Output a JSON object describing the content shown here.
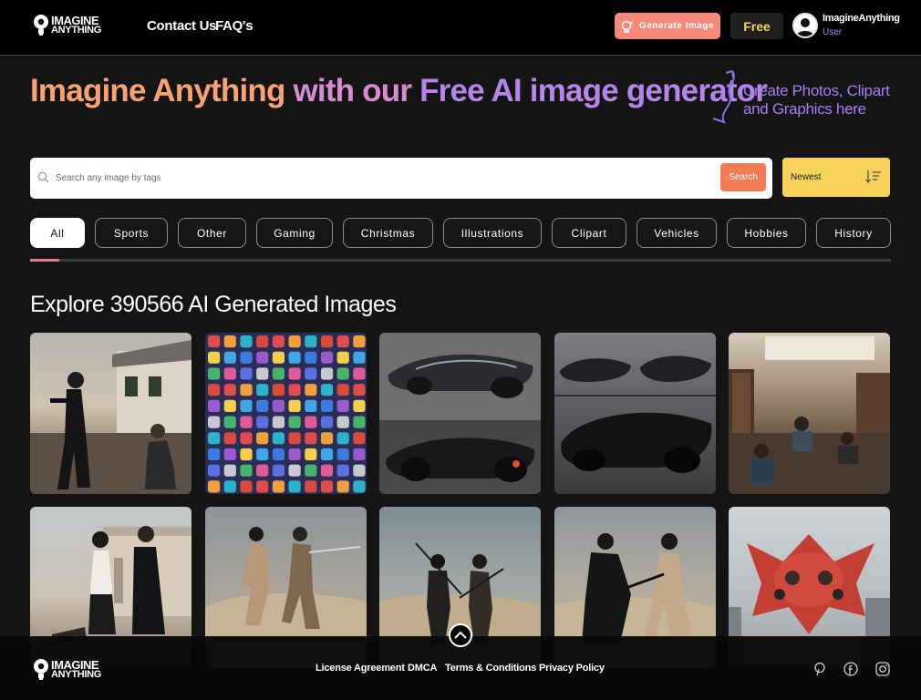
{
  "header": {
    "logo_line1": "IMAGINE",
    "logo_line2": "ANYTHING",
    "nav": [
      {
        "label": "Contact Us"
      },
      {
        "label": "FAQ's"
      }
    ],
    "generate_label": "Generate Image",
    "free_label": "Free",
    "user_name": "ImagineAnything",
    "user_role": "User"
  },
  "hero": {
    "title_part1": "Imagine Anything",
    "title_part2": "with our",
    "title_part3": "Free AI image generator",
    "subtitle": "Create Photos, Clipart and Graphics here"
  },
  "search": {
    "placeholder": "Search any image by tags",
    "button_label": "Search",
    "sort_selected": "Newest"
  },
  "categories": [
    {
      "label": "All",
      "active": true
    },
    {
      "label": "Sports"
    },
    {
      "label": "Other"
    },
    {
      "label": "Gaming"
    },
    {
      "label": "Christmas"
    },
    {
      "label": "Illustrations"
    },
    {
      "label": "Clipart"
    },
    {
      "label": "Vehicles"
    },
    {
      "label": "Hobbies"
    },
    {
      "label": "History"
    }
  ],
  "explore": {
    "title": "Explore 390566 AI Generated Images"
  },
  "gallery": [
    {
      "subject": "woman-aiming-gun-near-house"
    },
    {
      "subject": "social-media-app-icons-grid"
    },
    {
      "subject": "futuristic-black-cars"
    },
    {
      "subject": "futuristic-black-cars-collage"
    },
    {
      "subject": "people-studying-in-library"
    },
    {
      "subject": "couple-in-desert-near-house"
    },
    {
      "subject": "sword-fight-in-desert"
    },
    {
      "subject": "sword-duel-in-desert"
    },
    {
      "subject": "samurai-duel-in-desert"
    },
    {
      "subject": "red-spaceship-in-city"
    }
  ],
  "footer": {
    "links": [
      {
        "label": "License Agreement"
      },
      {
        "label": "DMCA"
      },
      {
        "label": "Terms & Conditions"
      },
      {
        "label": "Privacy Policy"
      }
    ],
    "socials": [
      "pinterest-icon",
      "facebook-icon",
      "instagram-icon"
    ]
  },
  "colors": {
    "accent_orange": "#f47a56",
    "accent_yellow": "#f7d25a",
    "accent_purple": "#a77df4",
    "generate_button": "#f4897a"
  }
}
